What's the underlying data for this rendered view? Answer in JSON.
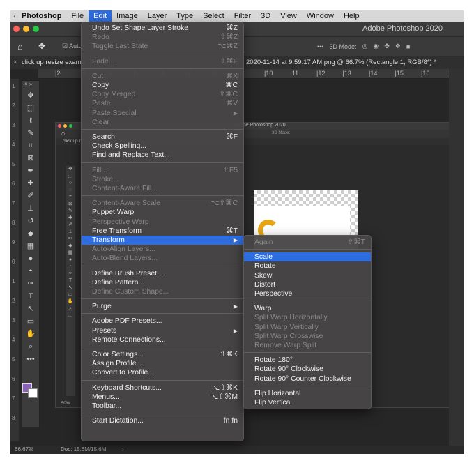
{
  "menubar": {
    "apple": "",
    "app": "Photoshop",
    "items": [
      "File",
      "Edit",
      "Image",
      "Layer",
      "Type",
      "Select",
      "Filter",
      "3D",
      "View",
      "Window",
      "Help"
    ],
    "active_item": "Edit"
  },
  "window": {
    "title": "Adobe Photoshop 2020",
    "traffic_light_colors": [
      "#fe5f57",
      "#febc2e",
      "#28c840"
    ]
  },
  "options_bar": {
    "home_icon": "home-icon",
    "move_icon": "move-tool-icon",
    "auto_select_label": "Auto-",
    "mode_label": "3D Mode:"
  },
  "document": {
    "tab_left": "click up resize examp",
    "tab_right": "2020-11-14 at 9.59.17 AM.png @ 66.7% (Rectangle 1, RGB/8*) *",
    "ruler_ticks": [
      "2",
      "3",
      "4",
      "5",
      "6",
      "7",
      "8",
      "9",
      "10",
      "11",
      "12",
      "13",
      "14",
      "15",
      "16",
      "17"
    ],
    "vruler_ticks": [
      "1",
      "2",
      "3",
      "4",
      "5",
      "6",
      "7",
      "8",
      "9",
      "0",
      "1",
      "2",
      "3",
      "4",
      "5",
      "6",
      "7",
      "8"
    ]
  },
  "inner_screenshot": {
    "title": "Adobe Photoshop 2020",
    "tab": "click up r",
    "mode_label": "3D Mode:",
    "zoom": "50%"
  },
  "status": {
    "zoom": "66.67%",
    "doc": "Doc: 15.6M/15.6M",
    "arrow": "›"
  },
  "edit_menu": {
    "items": [
      {
        "label": "Undo Set Shape Layer Stroke",
        "shortcut": "⌘Z",
        "enabled": true
      },
      {
        "label": "Redo",
        "shortcut": "⇧⌘Z",
        "enabled": false
      },
      {
        "label": "Toggle Last State",
        "shortcut": "⌥⌘Z",
        "enabled": false
      },
      {
        "sep": true
      },
      {
        "label": "Fade...",
        "shortcut": "⇧⌘F",
        "enabled": false
      },
      {
        "sep": true
      },
      {
        "label": "Cut",
        "shortcut": "⌘X",
        "enabled": false
      },
      {
        "label": "Copy",
        "shortcut": "⌘C",
        "enabled": true
      },
      {
        "label": "Copy Merged",
        "shortcut": "⇧⌘C",
        "enabled": false
      },
      {
        "label": "Paste",
        "shortcut": "⌘V",
        "enabled": false
      },
      {
        "label": "Paste Special",
        "shortcut": "",
        "submenu": true,
        "enabled": false
      },
      {
        "label": "Clear",
        "shortcut": "",
        "enabled": false
      },
      {
        "sep": true
      },
      {
        "label": "Search",
        "shortcut": "⌘F",
        "enabled": true
      },
      {
        "label": "Check Spelling...",
        "shortcut": "",
        "enabled": true
      },
      {
        "label": "Find and Replace Text...",
        "shortcut": "",
        "enabled": true
      },
      {
        "sep": true
      },
      {
        "label": "Fill...",
        "shortcut": "⇧F5",
        "enabled": false
      },
      {
        "label": "Stroke...",
        "shortcut": "",
        "enabled": false
      },
      {
        "label": "Content-Aware Fill...",
        "shortcut": "",
        "enabled": false
      },
      {
        "sep": true
      },
      {
        "label": "Content-Aware Scale",
        "shortcut": "⌥⇧⌘C",
        "enabled": false
      },
      {
        "label": "Puppet Warp",
        "shortcut": "",
        "enabled": true
      },
      {
        "label": "Perspective Warp",
        "shortcut": "",
        "enabled": false
      },
      {
        "label": "Free Transform",
        "shortcut": "⌘T",
        "enabled": true
      },
      {
        "label": "Transform",
        "shortcut": "",
        "submenu": true,
        "enabled": true,
        "highlight": true
      },
      {
        "label": "Auto-Align Layers...",
        "shortcut": "",
        "enabled": false
      },
      {
        "label": "Auto-Blend Layers...",
        "shortcut": "",
        "enabled": false
      },
      {
        "sep": true
      },
      {
        "label": "Define Brush Preset...",
        "shortcut": "",
        "enabled": true
      },
      {
        "label": "Define Pattern...",
        "shortcut": "",
        "enabled": true
      },
      {
        "label": "Define Custom Shape...",
        "shortcut": "",
        "enabled": false
      },
      {
        "sep": true
      },
      {
        "label": "Purge",
        "shortcut": "",
        "submenu": true,
        "enabled": true
      },
      {
        "sep": true
      },
      {
        "label": "Adobe PDF Presets...",
        "shortcut": "",
        "enabled": true
      },
      {
        "label": "Presets",
        "shortcut": "",
        "submenu": true,
        "enabled": true
      },
      {
        "label": "Remote Connections...",
        "shortcut": "",
        "enabled": true
      },
      {
        "sep": true
      },
      {
        "label": "Color Settings...",
        "shortcut": "⇧⌘K",
        "enabled": true
      },
      {
        "label": "Assign Profile...",
        "shortcut": "",
        "enabled": true
      },
      {
        "label": "Convert to Profile...",
        "shortcut": "",
        "enabled": true
      },
      {
        "sep": true
      },
      {
        "label": "Keyboard Shortcuts...",
        "shortcut": "⌥⇧⌘K",
        "enabled": true
      },
      {
        "label": "Menus...",
        "shortcut": "⌥⇧⌘M",
        "enabled": true
      },
      {
        "label": "Toolbar...",
        "shortcut": "",
        "enabled": true
      },
      {
        "sep": true
      },
      {
        "label": "Start Dictation...",
        "shortcut": "fn fn",
        "enabled": true
      }
    ]
  },
  "transform_submenu": {
    "items": [
      {
        "label": "Again",
        "shortcut": "⇧⌘T",
        "enabled": false
      },
      {
        "sep": true
      },
      {
        "label": "Scale",
        "shortcut": "",
        "enabled": true,
        "highlight": true
      },
      {
        "label": "Rotate",
        "shortcut": "",
        "enabled": true
      },
      {
        "label": "Skew",
        "shortcut": "",
        "enabled": true
      },
      {
        "label": "Distort",
        "shortcut": "",
        "enabled": true
      },
      {
        "label": "Perspective",
        "shortcut": "",
        "enabled": true
      },
      {
        "sep": true
      },
      {
        "label": "Warp",
        "shortcut": "",
        "enabled": true
      },
      {
        "label": "Split Warp Horizontally",
        "shortcut": "",
        "enabled": false
      },
      {
        "label": "Split Warp Vertically",
        "shortcut": "",
        "enabled": false
      },
      {
        "label": "Split Warp Crosswise",
        "shortcut": "",
        "enabled": false
      },
      {
        "label": "Remove Warp Split",
        "shortcut": "",
        "enabled": false
      },
      {
        "sep": true
      },
      {
        "label": "Rotate 180°",
        "shortcut": "",
        "enabled": true
      },
      {
        "label": "Rotate 90° Clockwise",
        "shortcut": "",
        "enabled": true
      },
      {
        "label": "Rotate 90° Counter Clockwise",
        "shortcut": "",
        "enabled": true
      },
      {
        "sep": true
      },
      {
        "label": "Flip Horizontal",
        "shortcut": "",
        "enabled": true
      },
      {
        "label": "Flip Vertical",
        "shortcut": "",
        "enabled": true
      }
    ]
  },
  "toolbar_tools": [
    "move-tool-icon",
    "marquee-tool-icon",
    "lasso-tool-icon",
    "quick-select-tool-icon",
    "crop-tool-icon",
    "frame-tool-icon",
    "eyedropper-tool-icon",
    "healing-brush-icon",
    "brush-tool-icon",
    "clone-stamp-icon",
    "history-brush-icon",
    "eraser-tool-icon",
    "gradient-tool-icon",
    "blur-tool-icon",
    "dodge-tool-icon",
    "pen-tool-icon",
    "type-tool-icon",
    "path-select-icon",
    "rectangle-tool-icon",
    "hand-tool-icon",
    "zoom-tool-icon",
    "more-tools-icon"
  ],
  "colors": {
    "accent": "#2e6de0",
    "foreground_swatch": "#8a63b8",
    "background_swatch": "#ffffff",
    "logo_yellow": "#e7a513",
    "callout_red": "#c81c24"
  }
}
